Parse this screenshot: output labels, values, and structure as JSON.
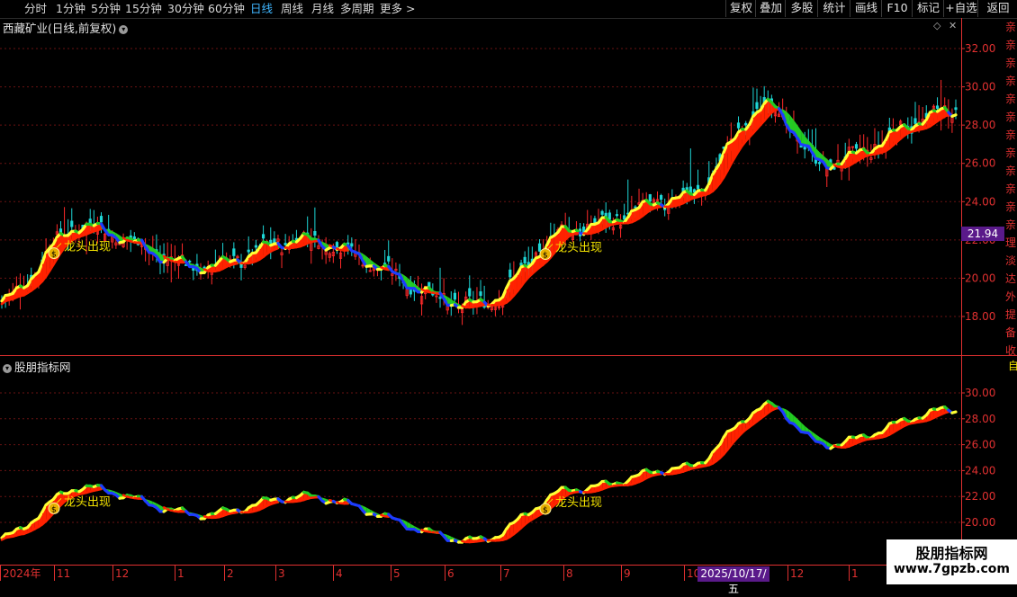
{
  "toolbar": {
    "periods": [
      "分时",
      "1分钟",
      "5分钟",
      "15分钟",
      "30分钟",
      "60分钟",
      "日线",
      "周线",
      "月线",
      "多周期",
      "更多 >"
    ],
    "active_period": "日线",
    "right_buttons": [
      "复权",
      "叠加",
      "多股",
      "统计",
      "画线",
      "F10",
      "标记",
      "+自选",
      "返回"
    ]
  },
  "main_pane": {
    "title": "西藏矿业(日线,前复权)",
    "current_price_label": "21.94"
  },
  "indicator_pane": {
    "title": "股朋指标网",
    "right_top_char": "自"
  },
  "right_strip_chars": [
    "亲",
    "亲",
    "亲",
    "亲",
    "亲",
    "亲",
    "亲",
    "亲",
    "亲",
    "亲",
    "亲",
    "亲",
    "理",
    "淡",
    "达",
    "外",
    "提",
    "备",
    "收"
  ],
  "signal_label": "龙头出现",
  "x_axis": {
    "labels": [
      "2024年",
      "11",
      "12",
      "1",
      "2",
      "3",
      "4",
      "5",
      "6",
      "7",
      "8",
      "9",
      "10",
      "12",
      "1"
    ],
    "cursor_label": "2025/10/17/五"
  },
  "watermark": {
    "line1": "股朋指标网",
    "line2": "www.7gpzb.com"
  },
  "colors": {
    "up": "#ff2a2a",
    "down": "#1ed6d6",
    "rising_fast": "#ffff33",
    "rising": "#ff2200",
    "falling": "#1d3cff",
    "flat": "#22cc22",
    "axis": "#e03030",
    "highlight": "#5a1a8a"
  },
  "chart_data": [
    {
      "type": "candlestick",
      "title": "西藏矿业(日线,前复权)",
      "y_ticks": [
        18.0,
        20.0,
        22.0,
        24.0,
        26.0,
        28.0,
        30.0,
        32.0
      ],
      "ylim": [
        16.0,
        33.0
      ],
      "last_price": 21.94,
      "ribbon_segments": [
        {
          "x_from": "2024年",
          "x_to": "11",
          "start": 18.8,
          "end": 22.7
        },
        {
          "x_from": "11",
          "x_to": "2",
          "start": 22.7,
          "end": 20.6
        },
        {
          "x_from": "2",
          "x_to": "3",
          "start": 20.6,
          "end": 22.0
        },
        {
          "x_from": "3",
          "x_to": "6",
          "start": 22.0,
          "end": 18.6
        },
        {
          "x_from": "6",
          "x_to": "8",
          "start": 18.6,
          "end": 22.6
        },
        {
          "x_from": "8",
          "x_to": "10",
          "start": 22.6,
          "end": 24.2
        },
        {
          "x_from": "10",
          "x_to": "12",
          "start": 24.2,
          "end": 29.0
        },
        {
          "x_from": "12",
          "x_to": "1",
          "start": 29.0,
          "end": 26.0
        },
        {
          "x_from": "1",
          "x_to": "end",
          "start": 26.0,
          "end": 28.7
        }
      ],
      "signals": [
        "龙头出现",
        "龙头出现"
      ]
    },
    {
      "type": "line",
      "title": "股朋指标网",
      "y_ticks": [
        20.0,
        22.0,
        24.0,
        26.0,
        28.0,
        30.0
      ],
      "signals": [
        "龙头出现",
        "龙头出现"
      ]
    }
  ]
}
